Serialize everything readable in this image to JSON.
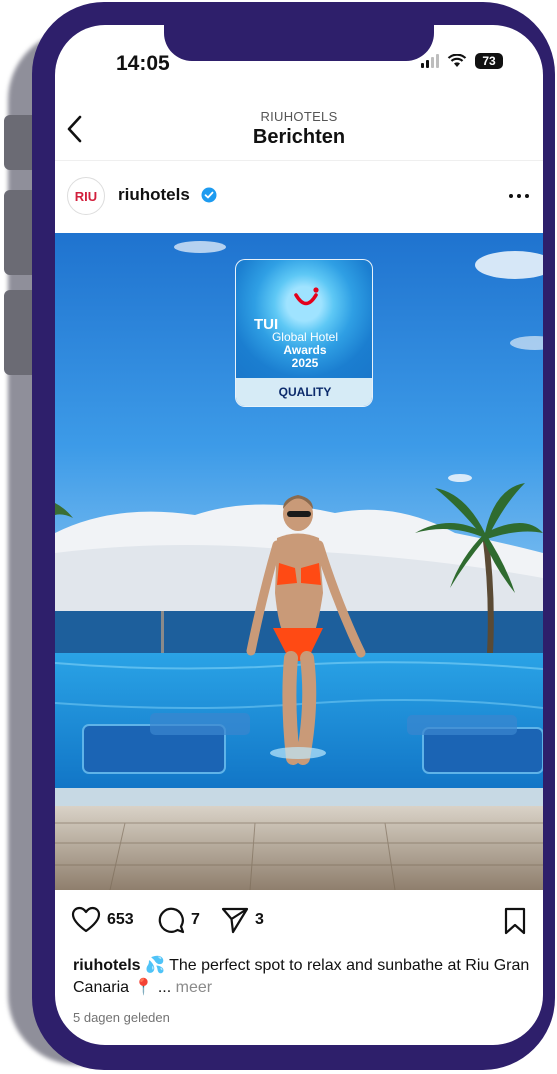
{
  "status_bar": {
    "time": "14:05",
    "battery": "73"
  },
  "header": {
    "account_caption": "RIUHOTELS",
    "title": "Berichten"
  },
  "post": {
    "avatar_text": "RIU",
    "username": "riuhotels",
    "verified": true,
    "image": {
      "award": {
        "brand": "TUI",
        "line1": "Global Hotel",
        "line2": "Awards",
        "line3": "2025",
        "quality": "QUALITY"
      }
    },
    "likes": "653",
    "comments": "7",
    "shares": "3",
    "caption_user": "riuhotels",
    "caption_text": " 💦 The perfect spot to relax and sunbathe at Riu Gran Canaria 📍 ... ",
    "caption_more": "meer",
    "time_ago": "5 dagen geleden"
  },
  "colors": {
    "frame": "#2e1f6b",
    "verified": "#1d9bf0",
    "riu_red": "#d21f3c"
  }
}
